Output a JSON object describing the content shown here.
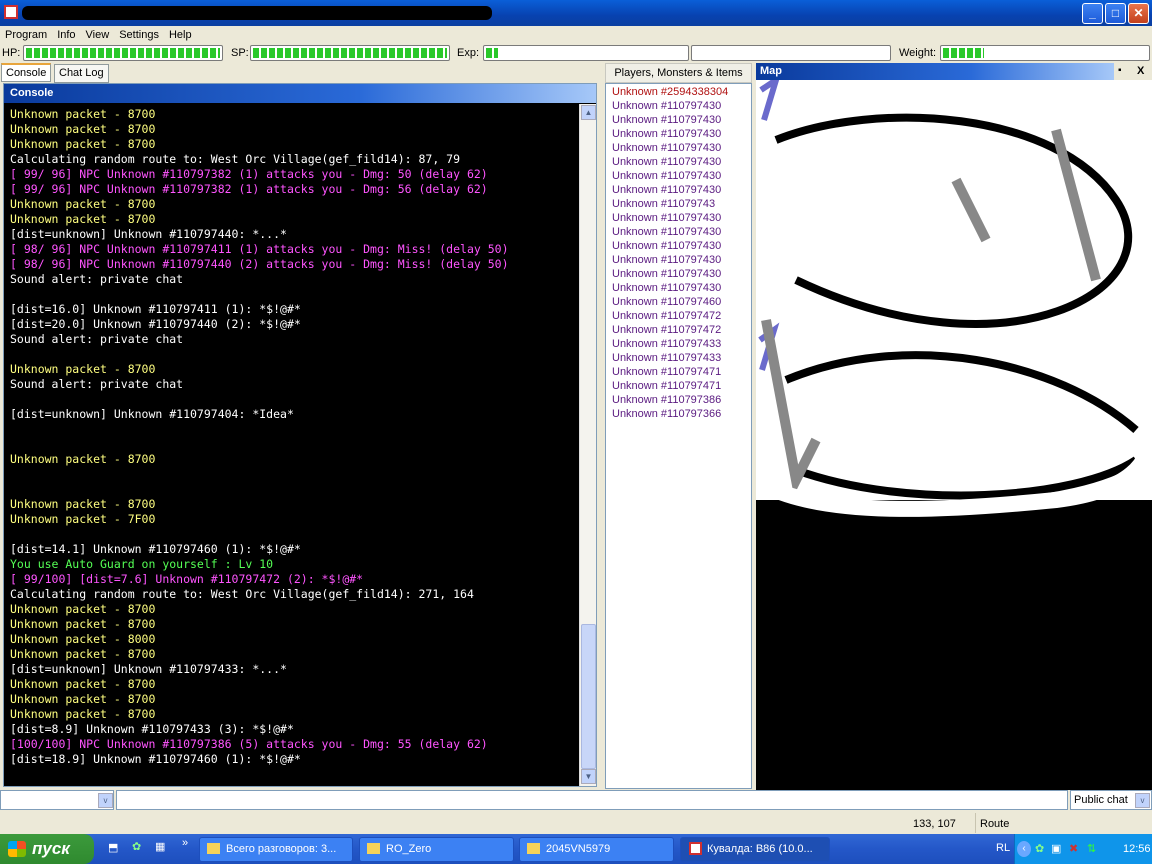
{
  "window": {
    "title": "",
    "minimize": "_",
    "maximize": "□",
    "close": "✕"
  },
  "menu": [
    "Program",
    "Info",
    "View",
    "Settings",
    "Help"
  ],
  "stats": {
    "hp_label": "HP:",
    "hp_fill": 1.0,
    "sp_label": "SP:",
    "sp_fill": 1.0,
    "exp_label": "Exp:",
    "exp_fill": 0.06,
    "weight_label": "Weight:",
    "weight_fill": 0.2
  },
  "tabs": [
    "Console",
    "Chat Log"
  ],
  "console": {
    "title": "Console",
    "lines": [
      {
        "t": "Unknown packet - 8700",
        "c": "yellow"
      },
      {
        "t": "Unknown packet - 8700",
        "c": "yellow"
      },
      {
        "t": "Unknown packet - 8700",
        "c": "yellow"
      },
      {
        "t": "Calculating random route to: West Orc Village(gef_fild14): 87, 79",
        "c": "white"
      },
      {
        "t": "[ 99/ 96] NPC Unknown #110797382 (1) attacks you - Dmg: 50 (delay 62)",
        "c": "magenta"
      },
      {
        "t": "[ 99/ 96] NPC Unknown #110797382 (1) attacks you - Dmg: 56 (delay 62)",
        "c": "magenta"
      },
      {
        "t": "Unknown packet - 8700",
        "c": "yellow"
      },
      {
        "t": "Unknown packet - 8700",
        "c": "yellow"
      },
      {
        "t": "[dist=unknown] Unknown #110797440: *...*",
        "c": "white"
      },
      {
        "t": "[ 98/ 96] NPC Unknown #110797411 (1) attacks you - Dmg: Miss! (delay 50)",
        "c": "magenta"
      },
      {
        "t": "[ 98/ 96] NPC Unknown #110797440 (2) attacks you - Dmg: Miss! (delay 50)",
        "c": "magenta"
      },
      {
        "t": "Sound alert: private chat",
        "c": "white"
      },
      {
        "t": "",
        "c": "white"
      },
      {
        "t": "[dist=16.0] Unknown #110797411 (1): *$!@#*",
        "c": "white"
      },
      {
        "t": "[dist=20.0] Unknown #110797440 (2): *$!@#*",
        "c": "white"
      },
      {
        "t": "Sound alert: private chat",
        "c": "white"
      },
      {
        "t": "",
        "c": "white"
      },
      {
        "t": "Unknown packet - 8700",
        "c": "yellow"
      },
      {
        "t": "Sound alert: private chat",
        "c": "white"
      },
      {
        "t": "",
        "c": "white"
      },
      {
        "t": "[dist=unknown] Unknown #110797404: *Idea*",
        "c": "white"
      },
      {
        "t": "",
        "c": "white"
      },
      {
        "t": "",
        "c": "white"
      },
      {
        "t": "Unknown packet - 8700",
        "c": "yellow"
      },
      {
        "t": "",
        "c": "white"
      },
      {
        "t": "",
        "c": "white"
      },
      {
        "t": "Unknown packet - 8700",
        "c": "yellow"
      },
      {
        "t": "Unknown packet - 7F00",
        "c": "yellow"
      },
      {
        "t": "",
        "c": "white"
      },
      {
        "t": "[dist=14.1] Unknown #110797460 (1): *$!@#*",
        "c": "white"
      },
      {
        "t": "You use Auto Guard on yourself : Lv 10",
        "c": "green"
      },
      {
        "t": "[ 99/100] [dist=7.6] Unknown #110797472 (2): *$!@#*",
        "c": "magenta"
      },
      {
        "t": "Calculating random route to: West Orc Village(gef_fild14): 271, 164",
        "c": "white"
      },
      {
        "t": "Unknown packet - 8700",
        "c": "yellow"
      },
      {
        "t": "Unknown packet - 8700",
        "c": "yellow"
      },
      {
        "t": "Unknown packet - 8000",
        "c": "yellow"
      },
      {
        "t": "Unknown packet - 8700",
        "c": "yellow"
      },
      {
        "t": "[dist=unknown] Unknown #110797433: *...*",
        "c": "white"
      },
      {
        "t": "Unknown packet - 8700",
        "c": "yellow"
      },
      {
        "t": "Unknown packet - 8700",
        "c": "yellow"
      },
      {
        "t": "Unknown packet - 8700",
        "c": "yellow"
      },
      {
        "t": "[dist=8.9] Unknown #110797433 (3): *$!@#*",
        "c": "white"
      },
      {
        "t": "[100/100] NPC Unknown #110797386 (5) attacks you - Dmg: 55 (delay 62)",
        "c": "magenta"
      },
      {
        "t": "[dist=18.9] Unknown #110797460 (1): *$!@#*",
        "c": "white"
      }
    ]
  },
  "colors": {
    "yellow": "#ffff80",
    "white": "#ffffff",
    "magenta": "#ff55ff",
    "green": "#55ff55",
    "player_red": "#b01010",
    "monster_purple": "#5a1a80"
  },
  "players": {
    "title": "Players, Monsters & Items",
    "items": [
      {
        "t": "Unknown #2594338304",
        "c": "player_red"
      },
      {
        "t": "Unknown #110797430",
        "c": "monster_purple"
      },
      {
        "t": "Unknown #110797430",
        "c": "monster_purple"
      },
      {
        "t": "Unknown #110797430",
        "c": "monster_purple"
      },
      {
        "t": "Unknown #110797430",
        "c": "monster_purple"
      },
      {
        "t": "Unknown #110797430",
        "c": "monster_purple"
      },
      {
        "t": "Unknown #110797430",
        "c": "monster_purple"
      },
      {
        "t": "Unknown #110797430",
        "c": "monster_purple"
      },
      {
        "t": "Unknown #11079743",
        "c": "monster_purple"
      },
      {
        "t": "Unknown #110797430",
        "c": "monster_purple"
      },
      {
        "t": "Unknown #110797430",
        "c": "monster_purple"
      },
      {
        "t": "Unknown #110797430",
        "c": "monster_purple"
      },
      {
        "t": "Unknown #110797430",
        "c": "monster_purple"
      },
      {
        "t": "Unknown #110797430",
        "c": "monster_purple"
      },
      {
        "t": "Unknown #110797430",
        "c": "monster_purple"
      },
      {
        "t": "Unknown #110797460",
        "c": "monster_purple"
      },
      {
        "t": "Unknown #110797472",
        "c": "monster_purple"
      },
      {
        "t": "Unknown #110797472",
        "c": "monster_purple"
      },
      {
        "t": "Unknown #110797433",
        "c": "monster_purple"
      },
      {
        "t": "Unknown #110797433",
        "c": "monster_purple"
      },
      {
        "t": "Unknown #110797471",
        "c": "monster_purple"
      },
      {
        "t": "Unknown #110797471",
        "c": "monster_purple"
      },
      {
        "t": "Unknown #110797386",
        "c": "monster_purple"
      },
      {
        "t": "Unknown #110797366",
        "c": "monster_purple"
      }
    ]
  },
  "map": {
    "title": "Map",
    "restore": "▪",
    "close": "X"
  },
  "input": {
    "target_value": "",
    "message_value": "",
    "chat_mode": "Public chat"
  },
  "status": {
    "coords": "133, 107",
    "state": "Route"
  },
  "taskbar": {
    "start": "пуск",
    "tasks": [
      {
        "label": "Всего разговоров: 3...",
        "icon": "folder-chat-icon"
      },
      {
        "label": "RO_Zero",
        "icon": "folder-icon"
      },
      {
        "label": "2045VN5979",
        "icon": "folder-icon"
      },
      {
        "label": "Кувалда:  B86 (10.0...",
        "icon": "app-icon",
        "active": true
      }
    ],
    "lang": "RL",
    "clock": "12:56"
  }
}
